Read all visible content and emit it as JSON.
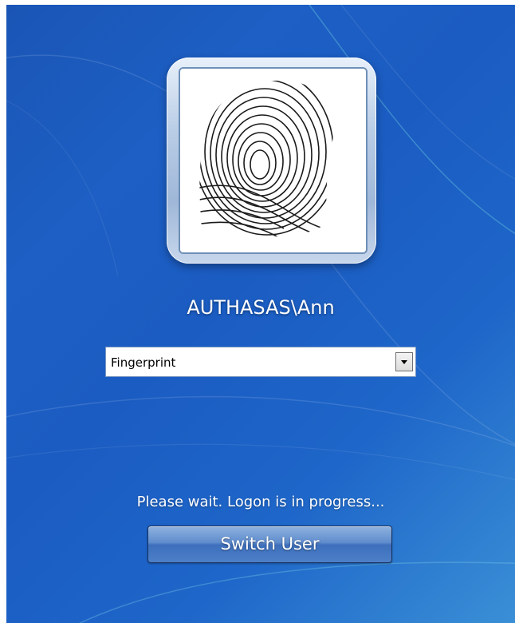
{
  "user_tile": {
    "image_icon": "fingerprint-icon",
    "username": "AUTHASAS\\Ann"
  },
  "credential_provider": {
    "selected": "Fingerprint",
    "arrow_icon": "chevron-down-icon"
  },
  "status_text": "Please wait. Logon is in progress...",
  "switch_user_button": {
    "label": "Switch User"
  },
  "colors": {
    "background": "#1d5fc4",
    "text": "#ffffff"
  }
}
